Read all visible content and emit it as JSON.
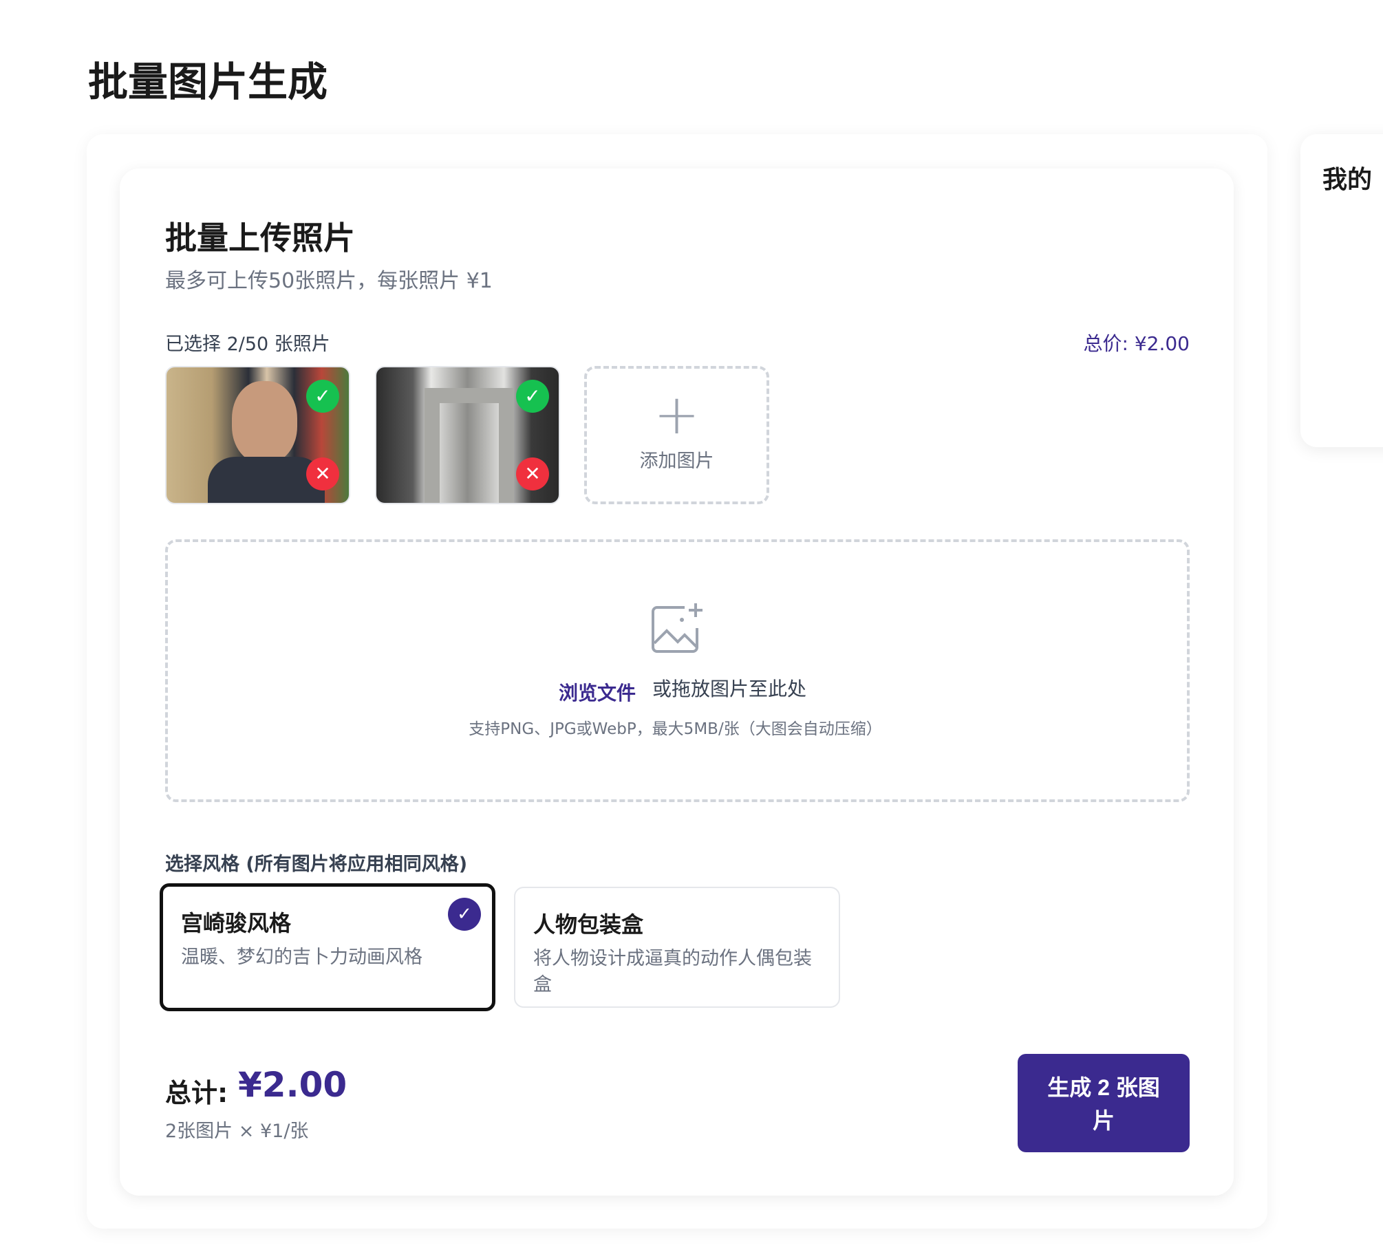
{
  "page_title": "批量图片生成",
  "right_panel": {
    "title": "我的"
  },
  "upload": {
    "title": "批量上传照片",
    "subtitle": "最多可上传50张照片，每张照片 ¥1",
    "selected_count": "已选择 2/50 张照片",
    "total_price": "总价: ¥2.00",
    "thumbnails": [
      {
        "subject": "man-portrait",
        "status": "selected"
      },
      {
        "subject": "stone-archway-alley",
        "status": "selected"
      }
    ],
    "add_label": "添加图片",
    "dropzone": {
      "browse": "浏览文件",
      "drag": "或拖放图片至此处",
      "hint": "支持PNG、JPG或WebP，最大5MB/张（大图会自动压缩）"
    }
  },
  "styles": {
    "label": "选择风格 (所有图片将应用相同风格)",
    "options": [
      {
        "name": "宫崎骏风格",
        "desc": "温暖、梦幻的吉卜力动画风格",
        "selected": true
      },
      {
        "name": "人物包装盒",
        "desc": "将人物设计成逼真的动作人偶包装盒",
        "selected": false
      }
    ]
  },
  "summary": {
    "label": "总计:",
    "value": "¥2.00",
    "detail": "2张图片 × ¥1/张",
    "button": "生成 2 张图片"
  },
  "colors": {
    "accent": "#3b2a8f",
    "ok": "#16c150",
    "remove": "#f0303e"
  }
}
